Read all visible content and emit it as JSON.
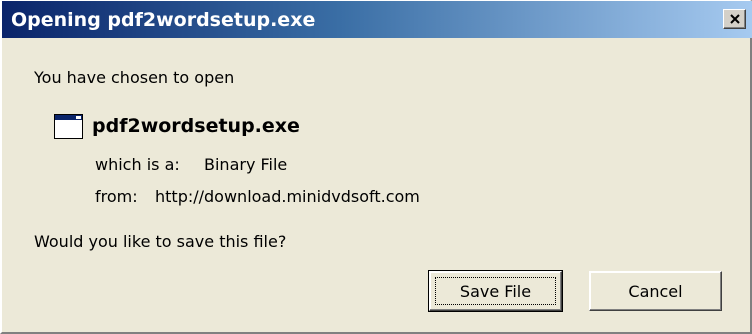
{
  "dialog": {
    "title": "Opening pdf2wordsetup.exe",
    "intro": "You have chosen to open",
    "file_name": "pdf2wordsetup.exe",
    "which_is_label": "which is a:",
    "which_is_value": "Binary File",
    "from_label": "from:",
    "from_value": "http://download.minidvdsoft.com",
    "question": "Would you like to save this file?",
    "buttons": {
      "save": "Save File",
      "cancel": "Cancel"
    },
    "icons": {
      "file": "application-window-icon",
      "close": "close-icon"
    },
    "colors": {
      "titlebar_start": "#0a246a",
      "titlebar_end": "#a6caf0",
      "dialog_background": "#ece9d8"
    }
  }
}
